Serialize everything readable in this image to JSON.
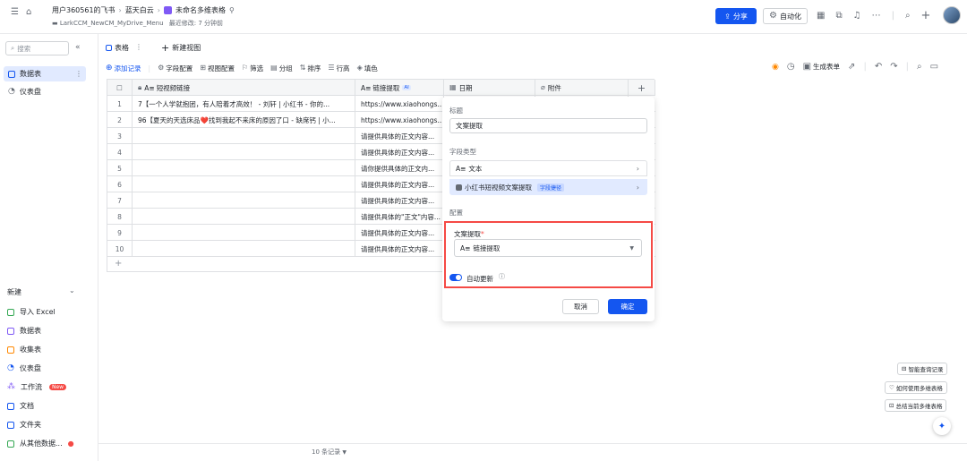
{
  "breadcrumb": {
    "workspace": "用户360561的飞书",
    "folder": "蓝天白云",
    "doc_title": "未命名多维表格"
  },
  "subline": {
    "path": "LarkCCM_NewCM_MyDrive_Menu",
    "modified": "最近修改: 7 分钟前"
  },
  "header": {
    "share_label": "分享",
    "automation_label": "自动化"
  },
  "sidebar": {
    "search_placeholder": "搜索",
    "items": [
      {
        "label": "数据表"
      },
      {
        "label": "仪表盘"
      }
    ],
    "new_section_label": "新建",
    "new_items": [
      {
        "label": "导入 Excel"
      },
      {
        "label": "数据表"
      },
      {
        "label": "收集表"
      },
      {
        "label": "仪表盘"
      },
      {
        "label": "工作流",
        "badge": "New"
      },
      {
        "label": "文档"
      },
      {
        "label": "文件夹"
      },
      {
        "label": "从其他数据..."
      }
    ]
  },
  "tabs": {
    "table_tab": "表格",
    "new_view": "新建视图"
  },
  "toolbar": {
    "add_record": "添加记录",
    "field_config": "字段配置",
    "view_config": "视图配置",
    "filter": "筛选",
    "group": "分组",
    "sort": "排序",
    "row_height": "行高",
    "fill_color": "填色",
    "generate_form": "生成表单"
  },
  "table": {
    "columns": {
      "video_link": "短视频链接",
      "link_extract": "链接提取",
      "ai_tag": "AI",
      "date": "日期",
      "attachment": "附件"
    },
    "rows": [
      {
        "n": "1",
        "link": "7【一个人学就抱团，有人陪着才高效！ - 刘轩 | 小红书 - 你的...",
        "extract": "https://www.xiaohongs..."
      },
      {
        "n": "2",
        "link": "96【夏天的天选床品❤️找到我起不来床的原因了口 - 缺席钙 | 小...",
        "extract": "https://www.xiaohongs..."
      },
      {
        "n": "3",
        "link": "",
        "extract": "请提供具体的正文内容..."
      },
      {
        "n": "4",
        "link": "",
        "extract": "请提供具体的正文内容..."
      },
      {
        "n": "5",
        "link": "",
        "extract": "请你提供具体的正文内..."
      },
      {
        "n": "6",
        "link": "",
        "extract": "请提供具体的正文内容..."
      },
      {
        "n": "7",
        "link": "",
        "extract": "请提供具体的正文内容..."
      },
      {
        "n": "8",
        "link": "",
        "extract": "请提供具体的\"正文\"内容..."
      },
      {
        "n": "9",
        "link": "",
        "extract": "请提供具体的正文内容..."
      },
      {
        "n": "10",
        "link": "",
        "extract": "请提供具体的正文内容..."
      }
    ]
  },
  "panel": {
    "title_label": "标题",
    "title_value": "文案提取",
    "field_type_label": "字段类型",
    "type_text": "文本",
    "type_extension": "小红书短视频文案提取",
    "extension_tag": "字段捷径",
    "config_label": "配置",
    "config_field_label": "文案提取",
    "required_mark": "*",
    "config_field_value": "链接提取",
    "auto_update_label": "自动更新",
    "cancel_label": "取消",
    "confirm_label": "确定"
  },
  "footer": {
    "record_count": "10 条记录"
  },
  "floating": {
    "smart_query": "智能查询记录",
    "how_to": "如何使用多维表格",
    "summarize": "总结当前多维表格"
  }
}
